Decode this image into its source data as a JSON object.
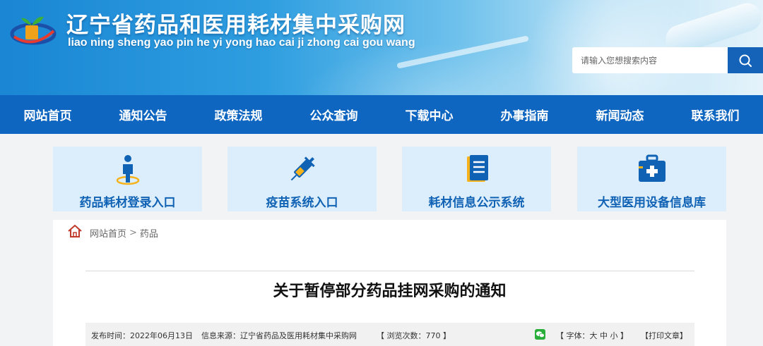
{
  "header": {
    "title": "辽宁省药品和医用耗材集中采购网",
    "pinyin": "liao ning sheng yao pin he yi yong hao cai ji zhong cai gou wang",
    "search_placeholder": "请输入您想搜索内容"
  },
  "nav": {
    "items": [
      "网站首页",
      "通知公告",
      "政策法规",
      "公众查询",
      "下载中心",
      "办事指南",
      "新闻动态",
      "联系我们"
    ]
  },
  "quick_links": [
    {
      "label": "药品耗材登录入口",
      "icon": "user-icon"
    },
    {
      "label": "疫苗系统入口",
      "icon": "syringe-icon"
    },
    {
      "label": "耗材信息公示系统",
      "icon": "document-icon"
    },
    {
      "label": "大型医用设备信息库",
      "icon": "medical-kit-icon"
    }
  ],
  "breadcrumb": {
    "home": "网站首页",
    "separator": ">",
    "current": "药品"
  },
  "article": {
    "title": "关于暂停部分药品挂网采购的通知",
    "publish_time": "发布时间：2022年06月13日",
    "source": "信息来源：辽宁省药品及医用耗材集中采购网",
    "views": "【 浏览次数：770 】",
    "font_size": "【 字体：大 中 小 】",
    "print": "【打印文章】"
  },
  "colors": {
    "nav_bg": "#0f66c0",
    "quick_bg": "#dceefb",
    "quick_text": "#1062b5",
    "accent_yellow": "#f5b21b"
  }
}
